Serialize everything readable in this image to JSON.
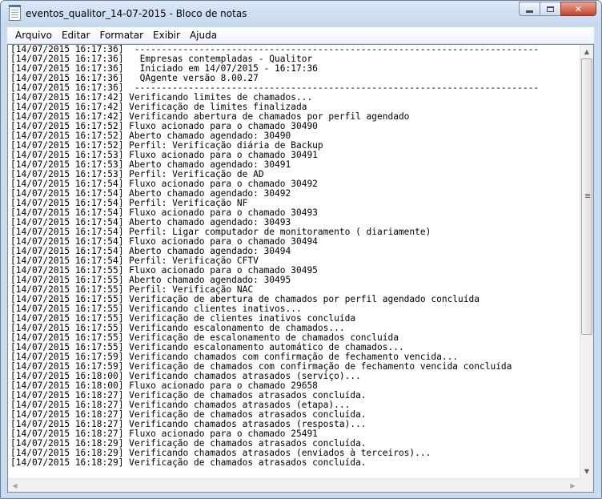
{
  "window": {
    "title": "eventos_qualitor_14-07-2015 - Bloco de notas"
  },
  "menu": [
    "Arquivo",
    "Editar",
    "Formatar",
    "Exibir",
    "Ajuda"
  ],
  "lines": [
    "[14/07/2015 16:17:36]  ---------------------------------------------------------------------------",
    "[14/07/2015 16:17:36]   Empresas contempladas - Qualitor",
    "[14/07/2015 16:17:36]   Iniciado em 14/07/2015 - 16:17:36",
    "[14/07/2015 16:17:36]   QAgente versão 8.00.27",
    "[14/07/2015 16:17:36]  ---------------------------------------------------------------------------",
    "[14/07/2015 16:17:42] Verificando limites de chamados...",
    "[14/07/2015 16:17:42] Verificação de limites finalizada",
    "[14/07/2015 16:17:42] Verificando abertura de chamados por perfil agendado",
    "[14/07/2015 16:17:52] Fluxo acionado para o chamado 30490",
    "[14/07/2015 16:17:52] Aberto chamado agendado: 30490",
    "[14/07/2015 16:17:52] Perfil: Verificação diária de Backup",
    "[14/07/2015 16:17:53] Fluxo acionado para o chamado 30491",
    "[14/07/2015 16:17:53] Aberto chamado agendado: 30491",
    "[14/07/2015 16:17:53] Perfil: Verificação de AD",
    "[14/07/2015 16:17:54] Fluxo acionado para o chamado 30492",
    "[14/07/2015 16:17:54] Aberto chamado agendado: 30492",
    "[14/07/2015 16:17:54] Perfil: Verificação NF",
    "[14/07/2015 16:17:54] Fluxo acionado para o chamado 30493",
    "[14/07/2015 16:17:54] Aberto chamado agendado: 30493",
    "[14/07/2015 16:17:54] Perfil: Ligar computador de monitoramento ( diariamente)",
    "[14/07/2015 16:17:54] Fluxo acionado para o chamado 30494",
    "[14/07/2015 16:17:54] Aberto chamado agendado: 30494",
    "[14/07/2015 16:17:54] Perfil: Verificação CFTV",
    "[14/07/2015 16:17:55] Fluxo acionado para o chamado 30495",
    "[14/07/2015 16:17:55] Aberto chamado agendado: 30495",
    "[14/07/2015 16:17:55] Perfil: Verificação NAC",
    "[14/07/2015 16:17:55] Verificação de abertura de chamados por perfil agendado concluída",
    "[14/07/2015 16:17:55] Verificando clientes inativos...",
    "[14/07/2015 16:17:55] Verificação de clientes inativos concluída",
    "[14/07/2015 16:17:55] Verificando escalonamento de chamados...",
    "[14/07/2015 16:17:55] Verificação de escalonamento de chamados concluída",
    "[14/07/2015 16:17:55] Verificando escalonamento automático de chamados...",
    "[14/07/2015 16:17:59] Verificando chamados com confirmação de fechamento vencida...",
    "[14/07/2015 16:17:59] Verificação de chamados com confirmação de fechamento vencida concluída",
    "[14/07/2015 16:18:00] Verificando chamados atrasados (serviço)...",
    "[14/07/2015 16:18:00] Fluxo acionado para o chamado 29658",
    "[14/07/2015 16:18:27] Verificação de chamados atrasados concluída.",
    "[14/07/2015 16:18:27] Verificando chamados atrasados (etapa)...",
    "[14/07/2015 16:18:27] Verificação de chamados atrasados concluída.",
    "[14/07/2015 16:18:27] Verificando chamados atrasados (resposta)...",
    "[14/07/2015 16:18:27] Fluxo acionado para o chamado 25491",
    "[14/07/2015 16:18:29] Verificação de chamados atrasados concluída.",
    "[14/07/2015 16:18:29] Verificando chamados atrasados (enviados à terceiros)...",
    "[14/07/2015 16:18:29] Verificação de chamados atrasados concluída."
  ]
}
